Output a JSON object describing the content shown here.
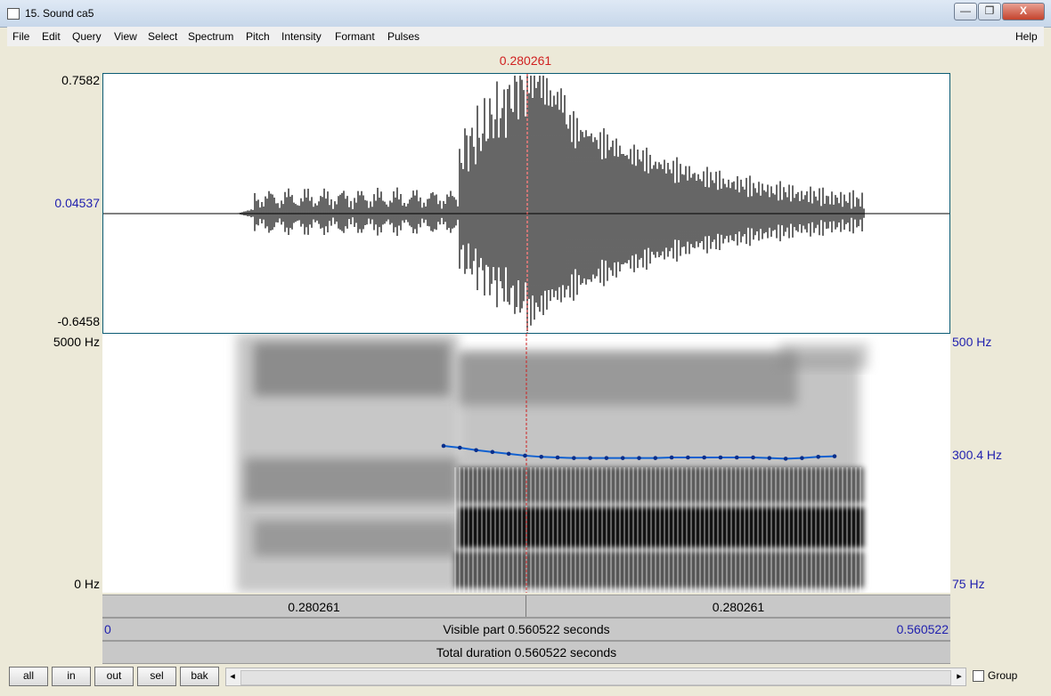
{
  "window": {
    "title": "15. Sound ca5",
    "minimize": "—",
    "maximize": "❐",
    "close": "X"
  },
  "menu": [
    "File",
    "Edit",
    "Query",
    "View",
    "Select",
    "Spectrum",
    "Pitch",
    "Intensity",
    "Formant",
    "Pulses"
  ],
  "menu_help": "Help",
  "cursor_time": "0.280261",
  "waveform": {
    "max": "0.7582",
    "mid": "0.04537",
    "min": "-0.6458"
  },
  "spectrogram": {
    "top": "5000 Hz",
    "bottom": "0 Hz"
  },
  "pitch_axis": {
    "top": "500 Hz",
    "mid": "300.4 Hz",
    "bottom": "75 Hz"
  },
  "pitch_contour_hz": [
    316,
    313,
    309,
    306,
    303,
    300,
    298,
    297,
    296,
    296,
    296,
    296,
    296,
    296,
    297,
    297,
    297,
    297,
    297,
    297,
    296,
    295,
    296,
    298,
    299
  ],
  "bars": {
    "left_seg": "0.280261",
    "right_seg": "0.280261",
    "visible_start": "0",
    "visible_label": "Visible part 0.560522 seconds",
    "visible_end": "0.560522",
    "total_label": "Total duration 0.560522 seconds"
  },
  "buttons": [
    "all",
    "in",
    "out",
    "sel",
    "bak"
  ],
  "scroll_left": "◂",
  "scroll_right": "▸",
  "group_label": "Group",
  "colors": {
    "cursor": "#d02020",
    "pitch": "#1060d0",
    "axis_blue": "#1f1fae"
  }
}
